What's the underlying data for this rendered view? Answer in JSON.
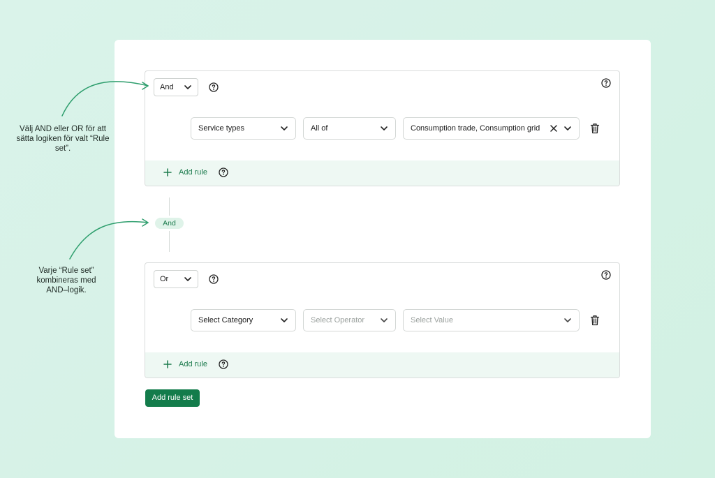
{
  "annotations": [
    {
      "text": "Välj AND eller OR för att sätta logiken för valt “Rule set”."
    },
    {
      "text": "Varje “Rule set” kombineras med AND–logik."
    }
  ],
  "rulesets": [
    {
      "logic": "And",
      "rule": {
        "category": "Service types",
        "operator": "All of",
        "value": "Consumption trade, Consumption grid",
        "category_placeholder": false,
        "operator_placeholder": false,
        "value_placeholder": false,
        "value_clearable": true
      },
      "add_rule_label": "Add rule"
    },
    {
      "logic": "Or",
      "rule": {
        "category": "Select Category",
        "operator": "Select Operator",
        "value": "Select Value",
        "category_placeholder": false,
        "operator_placeholder": true,
        "value_placeholder": true,
        "value_clearable": false
      },
      "add_rule_label": "Add rule"
    }
  ],
  "combinator_label": "And",
  "add_ruleset_label": "Add rule set",
  "icons": {
    "help": "question-circle-icon",
    "chevron": "chevron-down-icon",
    "clear": "close-icon",
    "delete": "trash-icon",
    "add": "plus-icon"
  },
  "colors": {
    "background": "#d8f3e8",
    "accent": "#137c4b",
    "footer": "#eef8f3",
    "pill": "#dff3e9"
  }
}
